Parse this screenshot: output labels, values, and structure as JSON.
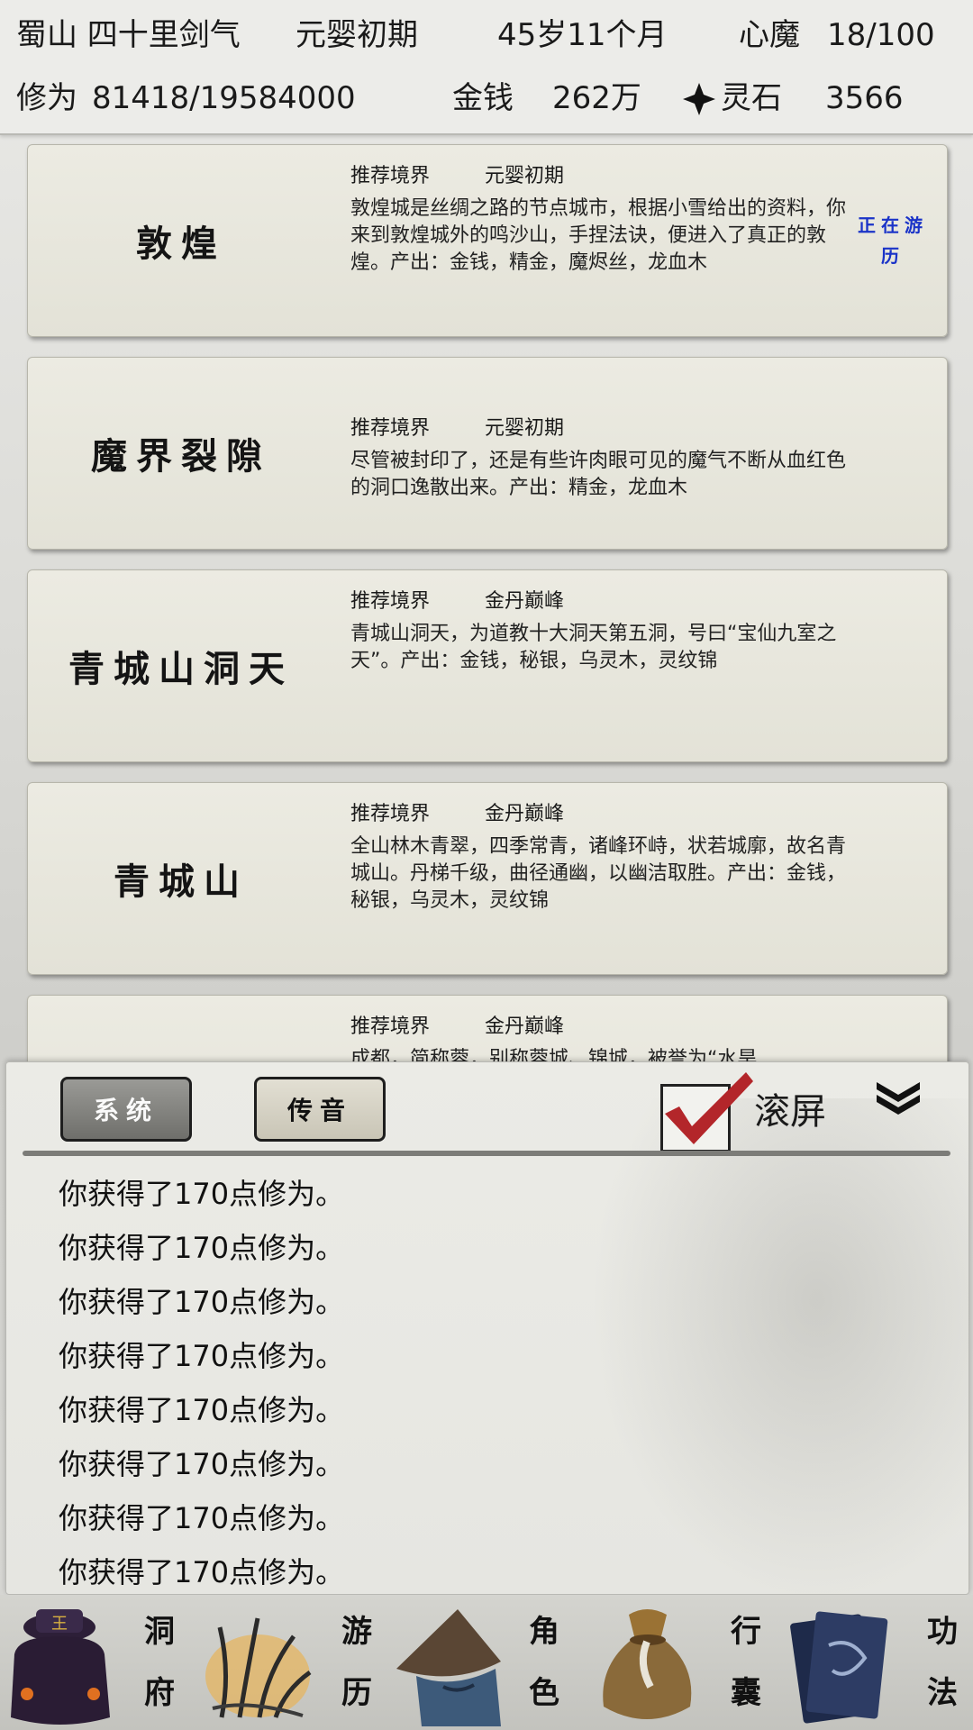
{
  "header": {
    "location": "蜀山 四十里剑气",
    "realm": "元婴初期",
    "age": "45岁11个月",
    "demon_label": "心魔",
    "demon_value": "18/100",
    "cultivation_label": "修为",
    "cultivation_value": "81418/19584000",
    "money_label": "金钱",
    "money_value": "262万",
    "spirit_stone_label": "灵石",
    "spirit_stone_value": "3566"
  },
  "locations": [
    {
      "name": "敦煌",
      "realm_label": "推荐境界",
      "realm": "元婴初期",
      "desc": "敦煌城是丝绸之路的节点城市，根据小雪给出的资料，你来到敦煌城外的鸣沙山，手捏法诀，便进入了真正的敦煌。产出：金钱，精金，魔烬丝，龙血木",
      "status": "正在游历"
    },
    {
      "name": "魔界裂隙",
      "realm_label": "推荐境界",
      "realm": "元婴初期",
      "desc": "尽管被封印了，还是有些许肉眼可见的魔气不断从血红色的洞口逸散出来。产出：精金，龙血木"
    },
    {
      "name": "青城山洞天",
      "realm_label": "推荐境界",
      "realm": "金丹巅峰",
      "desc": "青城山洞天，为道教十大洞天第五洞，号曰“宝仙九室之天”。产出：金钱，秘银，乌灵木，灵纹锦"
    },
    {
      "name": "青城山",
      "realm_label": "推荐境界",
      "realm": "金丹巅峰",
      "desc": "全山林木青翠，四季常青，诸峰环峙，状若城廓，故名青城山。丹梯千级，曲径通幽，以幽洁取胜。产出：金钱，秘银，乌灵木，灵纹锦"
    },
    {
      "name": "",
      "realm_label": "推荐境界",
      "realm": "金丹巅峰",
      "desc": "成都，简称蓉，别称蓉城、锦城，被誉为“水旱"
    }
  ],
  "chat": {
    "tab_system": "系统",
    "tab_voice": "传音",
    "scroll_label": "滚屏",
    "scroll_checked": true,
    "log": [
      "你获得了170点修为。",
      "你获得了170点修为。",
      "你获得了170点修为。",
      "你获得了170点修为。",
      "你获得了170点修为。",
      "你获得了170点修为。",
      "你获得了170点修为。",
      "你获得了170点修为。"
    ]
  },
  "nav": [
    {
      "icon": "pot-icon",
      "label1": "洞",
      "label2": "府"
    },
    {
      "icon": "grass-icon",
      "label1": "游",
      "label2": "历"
    },
    {
      "icon": "straw-hat-icon",
      "label1": "角",
      "label2": "色"
    },
    {
      "icon": "bag-icon",
      "label1": "行",
      "label2": "囊"
    },
    {
      "icon": "book-icon",
      "label1": "功",
      "label2": "法"
    }
  ],
  "colors": {
    "status_blue": "#1a33c8",
    "check_red": "#b3262a",
    "panel_bg": "#ecece9"
  }
}
